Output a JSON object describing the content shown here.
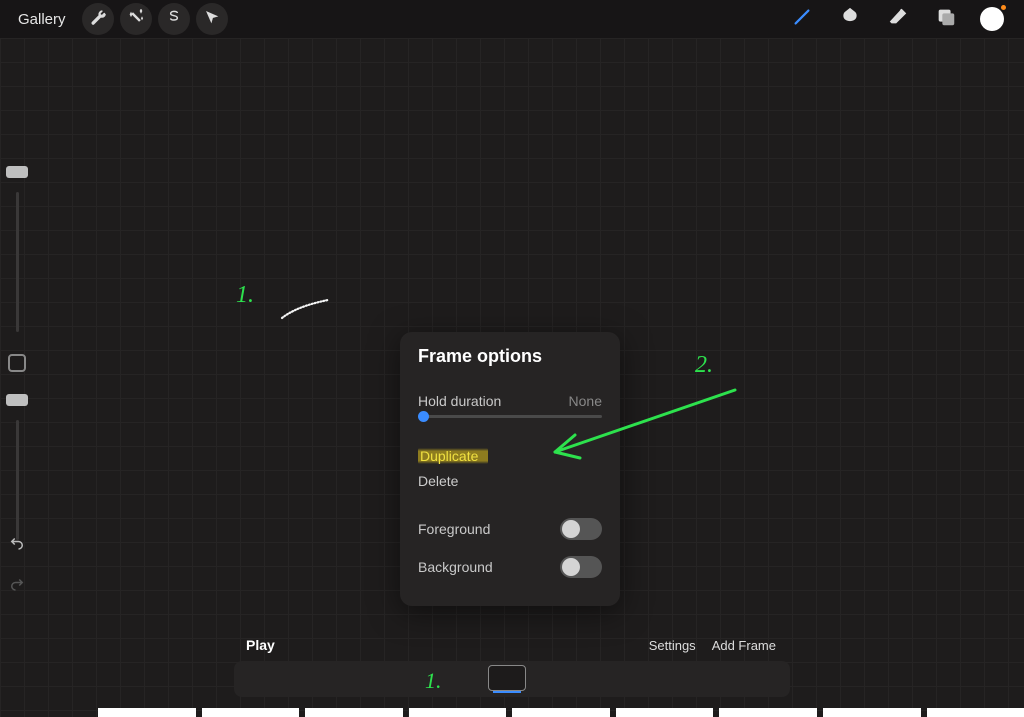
{
  "topbar": {
    "gallery": "Gallery"
  },
  "popover": {
    "title": "Frame options",
    "hold_label": "Hold duration",
    "hold_value": "None",
    "duplicate": "Duplicate",
    "delete": "Delete",
    "foreground": "Foreground",
    "background": "Background"
  },
  "bottombar": {
    "play": "Play",
    "settings": "Settings",
    "add_frame": "Add Frame"
  },
  "annotations": {
    "one": "1.",
    "two": "2.",
    "three": "1."
  },
  "colors": {
    "accent": "#3a8cff",
    "annotation": "#2de24d",
    "highlight": "#a08c1e"
  }
}
